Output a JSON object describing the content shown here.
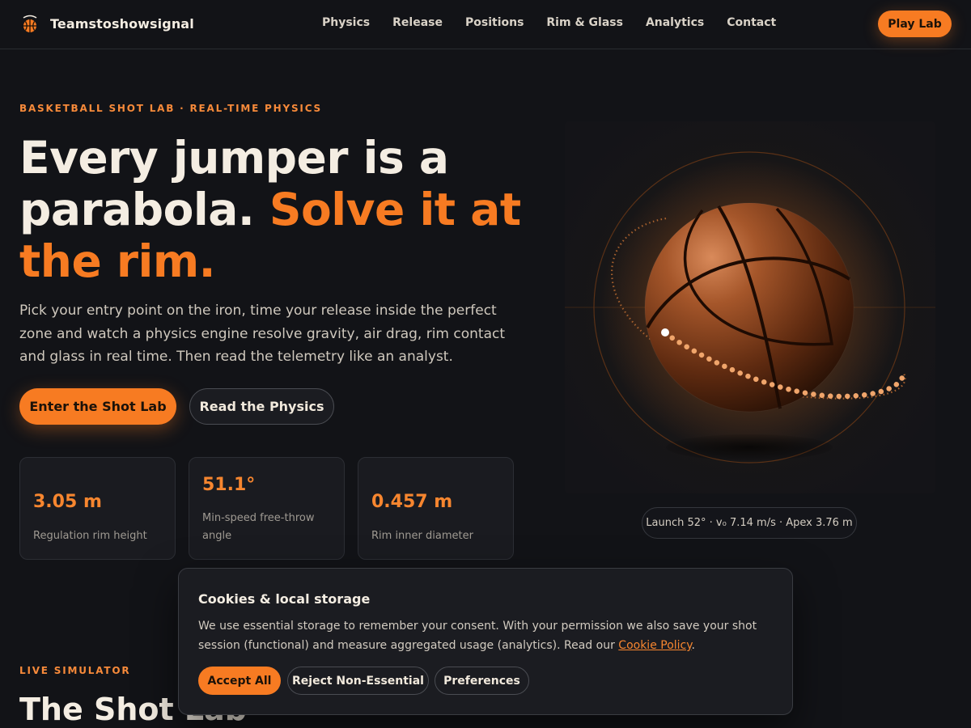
{
  "nav": {
    "brand": "Teamstoshowsignal",
    "links": [
      "Physics",
      "Release",
      "Positions",
      "Rim & Glass",
      "Analytics",
      "Contact"
    ],
    "cta": "Play Lab"
  },
  "hero": {
    "eyebrow": "BASKETBALL SHOT LAB · REAL-TIME PHYSICS",
    "title_part1": "Every jumper is a parabola.",
    "title_accent": "Solve it at the rim.",
    "description": "Pick your entry point on the iron, time your release inside the perfect zone and watch a physics engine resolve gravity, air drag, rim contact and glass in real time. Then read the telemetry like an analyst.",
    "primary_cta": "Enter the Shot Lab",
    "secondary_cta": "Read the Physics",
    "stats": [
      {
        "value": "3.05 m",
        "label": "Regulation rim height"
      },
      {
        "value": "51.1°",
        "label": "Min-speed free-throw angle"
      },
      {
        "value": "0.457 m",
        "label": "Rim inner diameter"
      }
    ],
    "readout": "Launch 52° · v₀ 7.14 m/s · Apex 3.76 m"
  },
  "section": {
    "eyebrow": "LIVE SIMULATOR",
    "title": "The Shot Lab"
  },
  "cookie": {
    "title": "Cookies & local storage",
    "text": "We use essential storage to remember your consent. With your permission we also save your shot session (functional) and measure aggregated usage (analytics). Read our",
    "link": "Cookie Policy",
    "text_end": ".",
    "accept": "Accept All",
    "reject": "Reject Non-Essential",
    "preferences": "Preferences"
  },
  "colors": {
    "accent": "#f77b22",
    "background": "#121317",
    "text": "#f4ede2"
  }
}
